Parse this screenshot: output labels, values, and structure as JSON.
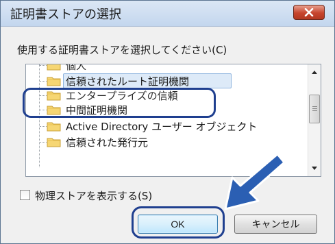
{
  "window": {
    "title": "証明書ストアの選択"
  },
  "prompt": "使用する証明書ストアを選択してください(C)",
  "tree": {
    "items": [
      {
        "label": "個人",
        "state": "partial"
      },
      {
        "label": "信頼されたルート証明機関",
        "state": "selected"
      },
      {
        "label": "エンタープライズの信頼",
        "state": "partial"
      },
      {
        "label": "中間証明機関",
        "state": "normal"
      },
      {
        "label": "Active Directory ユーザー オブジェクト",
        "state": "normal"
      },
      {
        "label": "信頼された発行元",
        "state": "normal"
      }
    ]
  },
  "checkbox": {
    "label": "物理ストアを表示する(S)",
    "checked": false
  },
  "buttons": {
    "ok": "OK",
    "cancel": "キャンセル"
  },
  "colors": {
    "annotation": "#1f3f8f",
    "arrow": "#2b5fb3",
    "selection": "#ddeaf8"
  },
  "icons": {
    "folder": "folder-icon",
    "close": "close-icon",
    "arrow": "pointer-arrow"
  }
}
